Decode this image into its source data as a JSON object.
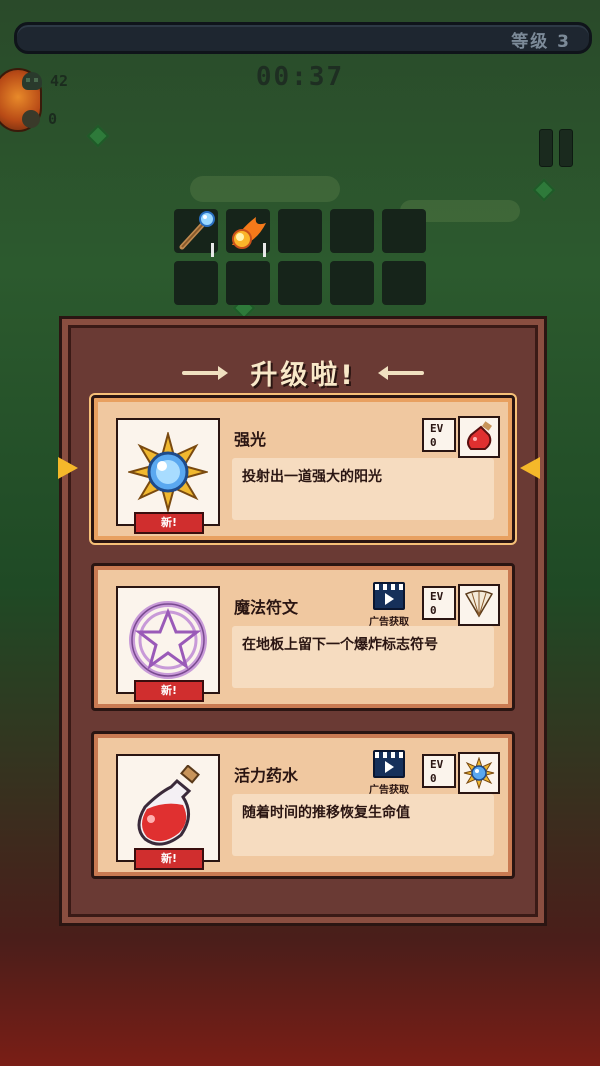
{
  "hud": {
    "level_label": "等级 3",
    "timer": "00:37",
    "kills": "42",
    "coins": "0"
  },
  "weapon_slots": {
    "filled": [
      "magic-staff-icon",
      "fireball-icon"
    ],
    "total": 10
  },
  "panel": {
    "title": "升级啦!"
  },
  "cards": [
    {
      "name": "强光",
      "description": "投射出一道强大的阳光",
      "badge": "新!",
      "ev_label": "EV",
      "ev_value": "0",
      "icon": "sun-orb-icon",
      "evolve_icon": "red-potion-icon",
      "ad": false
    },
    {
      "name": "魔法符文",
      "description": "在地板上留下一个爆炸标志符号",
      "badge": "新!",
      "ev_label": "EV",
      "ev_value": "0",
      "icon": "pentagram-rune-icon",
      "evolve_icon": "fan-icon",
      "ad": true,
      "ad_label": "广告获取"
    },
    {
      "name": "活力药水",
      "description": "随着时间的推移恢复生命值",
      "badge": "新!",
      "ev_label": "EV",
      "ev_value": "0",
      "icon": "red-potion-icon",
      "evolve_icon": "sun-orb-icon",
      "ad": true,
      "ad_label": "广告获取"
    }
  ],
  "colors": {
    "panel": "#6a3a34",
    "card": "#f0c8a0",
    "badge": "#d02e2e",
    "selector_arrow": "#f5b82a"
  }
}
